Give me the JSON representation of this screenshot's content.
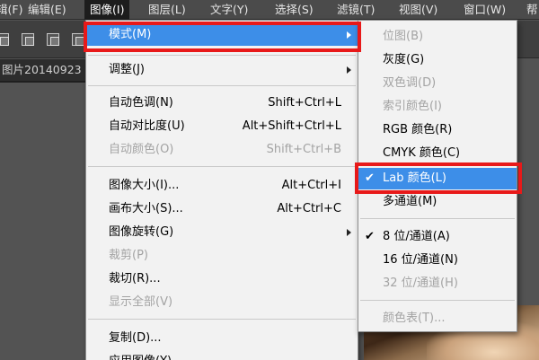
{
  "menubar": {
    "items": [
      {
        "label": "辑(F)"
      },
      {
        "label": "编辑(E)"
      },
      {
        "label": "图像(I)"
      },
      {
        "label": "图层(L)"
      },
      {
        "label": "文字(Y)"
      },
      {
        "label": "选择(S)"
      },
      {
        "label": "滤镜(T)"
      },
      {
        "label": "视图(V)"
      },
      {
        "label": "窗口(W)"
      },
      {
        "label": "帮"
      }
    ],
    "active_label": "图像(I)"
  },
  "document": {
    "tab_label": "图片20140923"
  },
  "image_menu": {
    "items": [
      {
        "label": "模式(M)",
        "shortcut": "",
        "submenu": true
      },
      {
        "label": "调整(J)",
        "shortcut": "",
        "submenu": true
      },
      {
        "label": "自动色调(N)",
        "shortcut": "Shift+Ctrl+L"
      },
      {
        "label": "自动对比度(U)",
        "shortcut": "Alt+Shift+Ctrl+L"
      },
      {
        "label": "自动颜色(O)",
        "shortcut": "Shift+Ctrl+B"
      },
      {
        "label": "图像大小(I)...",
        "shortcut": "Alt+Ctrl+I"
      },
      {
        "label": "画布大小(S)...",
        "shortcut": "Alt+Ctrl+C"
      },
      {
        "label": "图像旋转(G)",
        "shortcut": "",
        "submenu": true
      },
      {
        "label": "裁剪(P)",
        "shortcut": ""
      },
      {
        "label": "裁切(R)...",
        "shortcut": ""
      },
      {
        "label": "显示全部(V)",
        "shortcut": ""
      },
      {
        "label": "复制(D)...",
        "shortcut": ""
      },
      {
        "label": "应用图像(Y)...",
        "shortcut": ""
      }
    ]
  },
  "mode_submenu": {
    "items": [
      {
        "label": "位图(B)"
      },
      {
        "label": "灰度(G)"
      },
      {
        "label": "双色调(D)"
      },
      {
        "label": "索引颜色(I)"
      },
      {
        "label": "RGB 颜色(R)"
      },
      {
        "label": "CMYK 颜色(C)"
      },
      {
        "label": "Lab 颜色(L)",
        "checked": true
      },
      {
        "label": "多通道(M)"
      },
      {
        "label": "8 位/通道(A)",
        "checked": true
      },
      {
        "label": "16 位/通道(N)"
      },
      {
        "label": "32 位/通道(H)"
      },
      {
        "label": "颜色表(T)..."
      }
    ]
  },
  "check_glyph": "✔",
  "colors": {
    "highlight": "#3d8ee8",
    "annotation_red": "#e81919",
    "menu_bg": "#f2f2f2",
    "menubar_bg": "#4b4b4b"
  }
}
